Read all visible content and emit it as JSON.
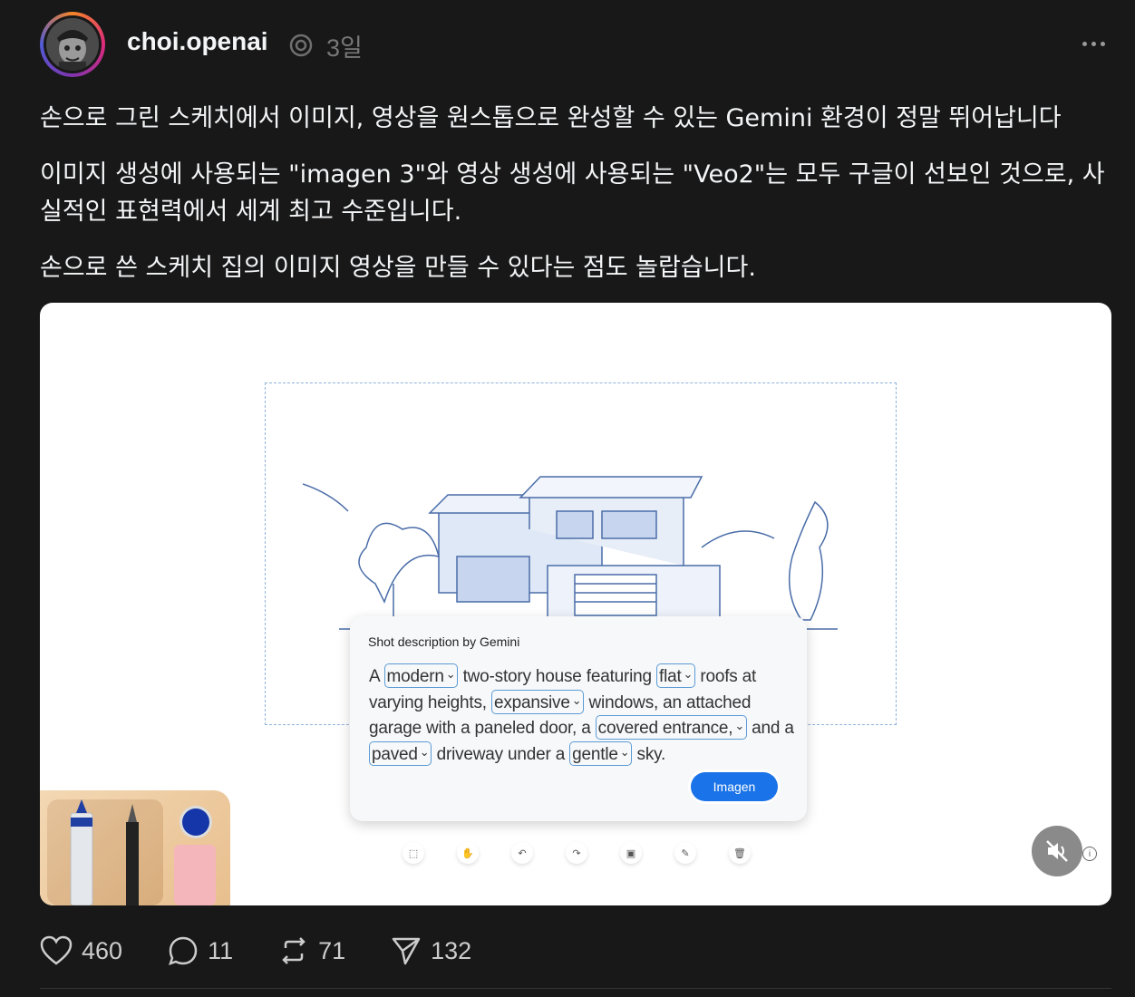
{
  "post": {
    "username": "choi.openai",
    "timestamp": "3일",
    "paragraphs": [
      "손으로 그린 스케치에서 이미지, 영상을 원스톱으로 완성할 수 있는 Gemini 환경이 정말 뛰어납니다",
      "이미지 생성에 사용되는 \"imagen 3\"와 영상 생성에 사용되는 \"Veo2\"는 모두 구글이 선보인 것으로, 사실적인 표현력에서 세계 최고 수준입니다.",
      "손으로 쓴 스케치 집의 이미지 영상을 만들 수 있다는 점도 놀랍습니다."
    ]
  },
  "media": {
    "card_title": "Shot description by Gemini",
    "description": {
      "t1": "A",
      "c1": "modern",
      "t2": "two-story house featuring",
      "c2": "flat",
      "t3": "roofs at varying heights,",
      "c3": "expansive",
      "t4": "windows, an attached garage with a paneled door, a",
      "c4": "covered entrance,",
      "t5": "and a",
      "c5": "paved",
      "t6": "driveway under a",
      "c6": "gentle",
      "t7": "sky."
    },
    "button_label": "Imagen"
  },
  "actions": {
    "likes": "460",
    "comments": "11",
    "reposts": "71",
    "shares": "132"
  },
  "colors": {
    "background": "#181818",
    "chip_border": "#5b9bd5",
    "imagen_button": "#1a73e8"
  }
}
